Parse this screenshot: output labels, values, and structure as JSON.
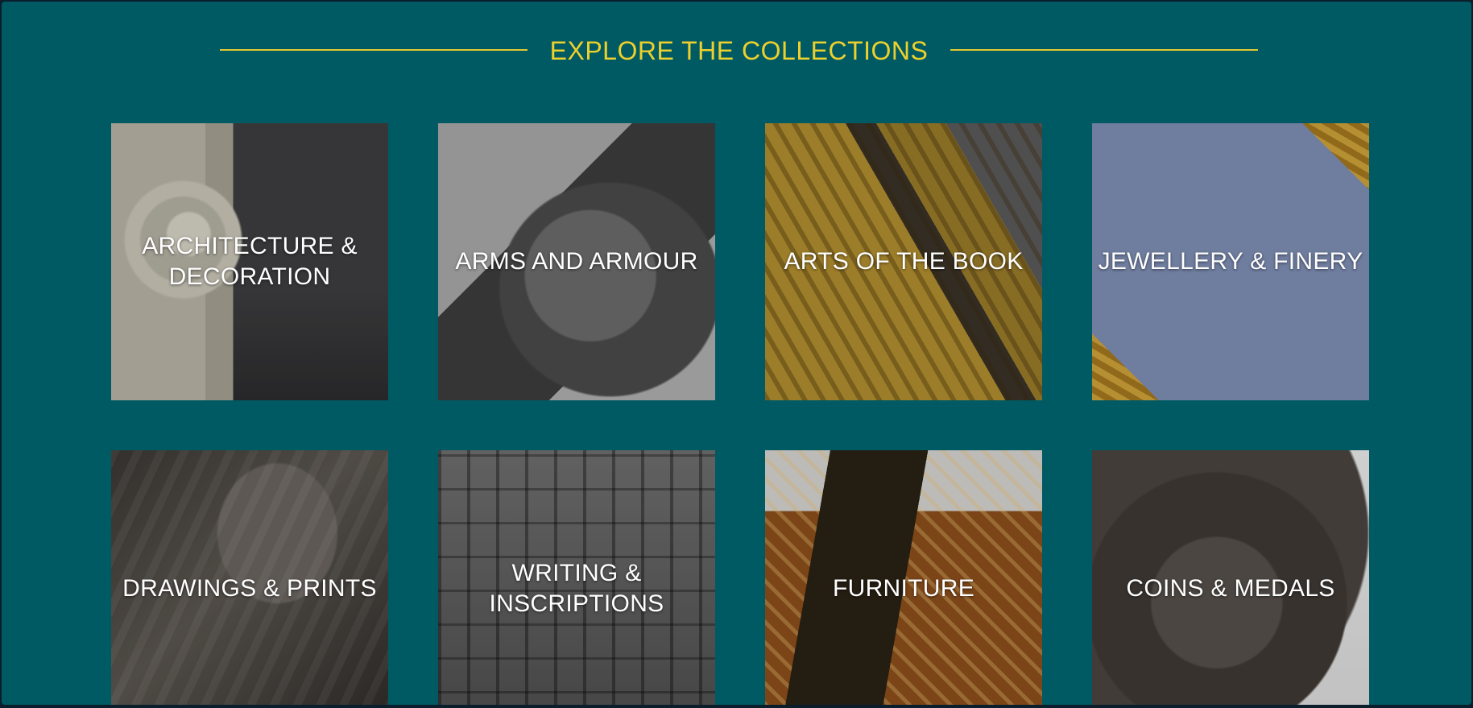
{
  "header": {
    "title": "EXPLORE THE COLLECTIONS"
  },
  "collections": [
    {
      "label": "ARCHITECTURE & DECORATION"
    },
    {
      "label": "ARMS AND ARMOUR"
    },
    {
      "label": "ARTS OF THE BOOK"
    },
    {
      "label": "JEWELLERY & FINERY"
    },
    {
      "label": "DRAWINGS & PRINTS"
    },
    {
      "label": "WRITING & INSCRIPTIONS"
    },
    {
      "label": "FURNITURE"
    },
    {
      "label": "COINS & MEDALS"
    }
  ],
  "colors": {
    "background": "#005a63",
    "accent": "#ecd02c",
    "label": "#ffffff"
  }
}
